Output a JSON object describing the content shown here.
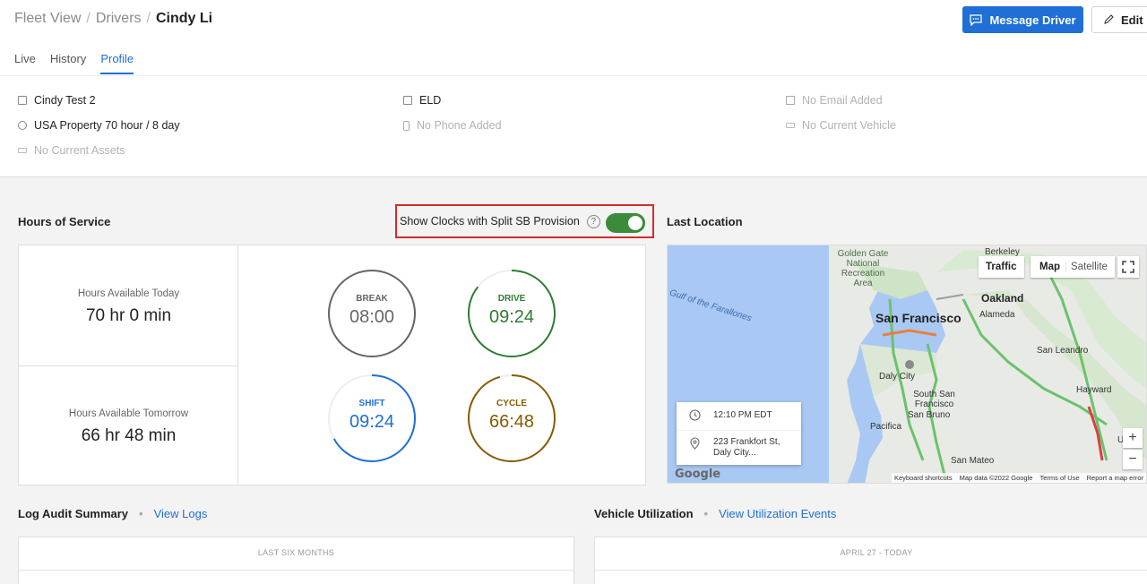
{
  "breadcrumb": {
    "item1": "Fleet View",
    "item2": "Drivers",
    "current": "Cindy Li",
    "separator": "/"
  },
  "actions": {
    "message_label": "Message Driver",
    "edit_label": "Edit"
  },
  "tabs": [
    {
      "label": "Live"
    },
    {
      "label": "History"
    },
    {
      "label": "Profile"
    }
  ],
  "profile": {
    "name": "Cindy Test 2",
    "ruleset": "USA Property 70 hour / 8 day",
    "assets": "No Current Assets",
    "eld": "ELD",
    "phone": "No Phone Added",
    "email": "No Email Added",
    "vehicle": "No Current Vehicle"
  },
  "hos": {
    "title": "Hours of Service",
    "toggle_label": "Show Clocks with Split SB Provision",
    "toggle_help": "?",
    "toggle_on": true,
    "today_label": "Hours Available Today",
    "today_value": "70 hr 0 min",
    "tomorrow_label": "Hours Available Tomorrow",
    "tomorrow_value": "66 hr 48 min",
    "clocks": [
      {
        "name": "BREAK",
        "time": "08:00",
        "color": "#666666",
        "fraction": 1.0
      },
      {
        "name": "DRIVE",
        "time": "09:24",
        "color": "#2e7d32",
        "fraction": 0.855
      },
      {
        "name": "SHIFT",
        "time": "09:24",
        "color": "#1f6fd6",
        "fraction": 0.67
      },
      {
        "name": "CYCLE",
        "time": "66:48",
        "color": "#8a5a00",
        "fraction": 0.954
      }
    ]
  },
  "map": {
    "title": "Last Location",
    "traffic_label": "Traffic",
    "map_label": "Map",
    "satellite_label": "Satellite",
    "zoom_in": "+",
    "zoom_out": "−",
    "time": "12:10 PM EDT",
    "address": "223 Frankfort St, Daly City...",
    "places": {
      "sf": "San Francisco",
      "oakland": "Oakland",
      "berkeley": "Berkeley",
      "alameda": "Alameda",
      "golden_gate": "Golden Gate National Recreation Area",
      "daly_city": "Daly City",
      "south_sf": "South San Francisco",
      "san_bruno": "San Bruno",
      "san_leandro": "San Leandro",
      "hayward": "Hayward",
      "pacifica": "Pacifica",
      "san_mateo": "San Mateo",
      "farallones": "Gulf of the Farallones",
      "union": "Uni"
    },
    "google_label": "Google",
    "attribution": [
      "Keyboard shortcuts",
      "Map data ©2022 Google",
      "Terms of Use",
      "Report a map error"
    ]
  },
  "log_audit": {
    "title": "Log Audit Summary",
    "link": "View Logs",
    "period": "LAST SIX MONTHS"
  },
  "utilization": {
    "title": "Vehicle Utilization",
    "link": "View Utilization Events",
    "period": "APRIL 27 - TODAY"
  }
}
